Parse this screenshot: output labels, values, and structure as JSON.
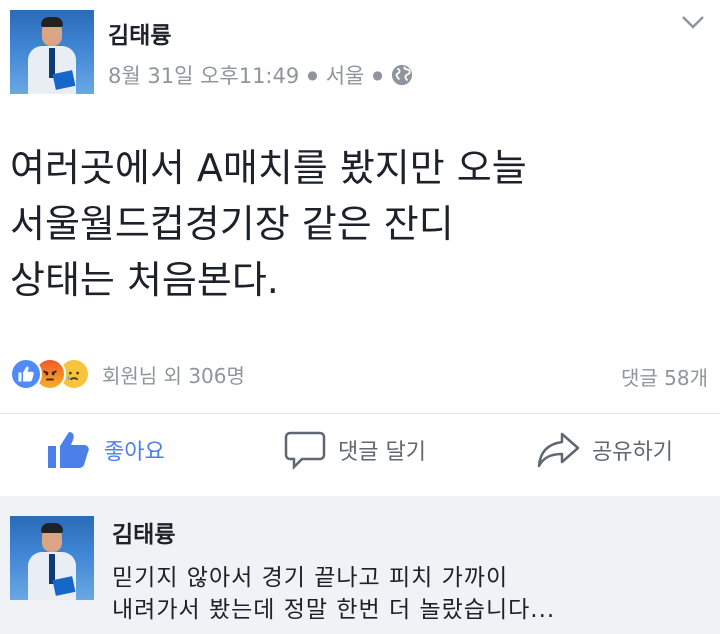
{
  "post": {
    "author": "김태륭",
    "timestamp": "8월 31일 오후11:49",
    "location": "서울",
    "body": "여러곳에서 A매치를 봤지만 오늘\n서울월드컵경기장 같은 잔디\n상태는 처음본다."
  },
  "reactions": {
    "types": [
      "like-icon",
      "angry-icon",
      "sad-icon"
    ],
    "summary": "회원님 외 306명",
    "comments": "댓글 58개"
  },
  "actions": {
    "like": "좋아요",
    "comment": "댓글 달기",
    "share": "공유하기"
  },
  "comment": {
    "author": "김태륭",
    "text": "믿기지 않아서 경기 끝나고 피치 가까이\n내려가서 봤는데 정말 한번 더 놀랐습니다..."
  },
  "colors": {
    "accent": "#4b80e8",
    "muted": "#90949c",
    "comment_bg": "#f1f2f5"
  }
}
